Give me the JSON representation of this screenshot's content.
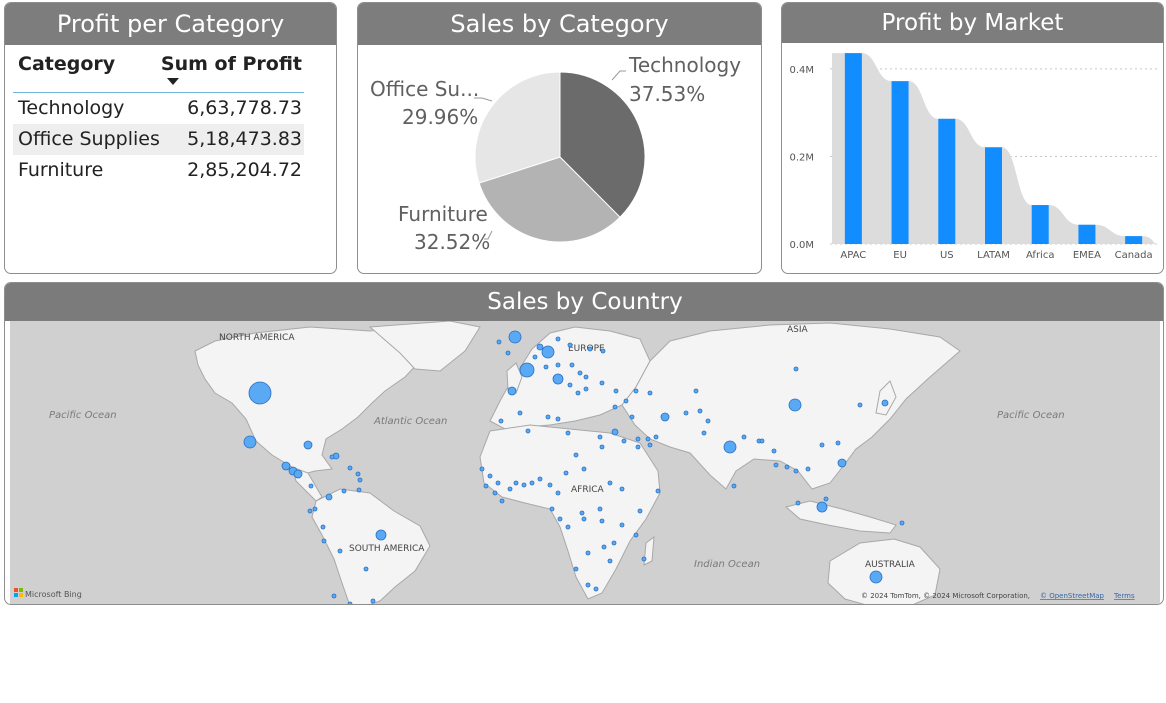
{
  "profit_table": {
    "title": "Profit per Category",
    "col_category": "Category",
    "col_profit": "Sum of Profit",
    "rows": [
      {
        "category": "Technology",
        "profit": "6,63,778.73"
      },
      {
        "category": "Office Supplies",
        "profit": "5,18,473.83"
      },
      {
        "category": "Furniture",
        "profit": "2,85,204.72"
      }
    ]
  },
  "sales_pie": {
    "title": "Sales by Category",
    "labels": [
      {
        "name": "Technology",
        "pct": "37.53%"
      },
      {
        "name": "Office Su...",
        "pct": "29.96%"
      },
      {
        "name": "Furniture",
        "pct": "32.52%"
      }
    ]
  },
  "market_chart": {
    "title": "Profit by Market"
  },
  "map": {
    "title": "Sales by Country",
    "labels": {
      "north_america": "NORTH AMERICA",
      "europe": "EUROPE",
      "asia": "ASIA",
      "africa": "AFRICA",
      "south_america": "SOUTH AMERICA",
      "australia": "AUSTRALIA",
      "pacific_w": "Pacific Ocean",
      "pacific_e": "Pacific Ocean",
      "atlantic": "Atlantic Ocean",
      "indian": "Indian Ocean"
    },
    "brand": "Microsoft Bing",
    "copyright": "© 2024 TomTom, © 2024 Microsoft Corporation,",
    "osm": "© OpenStreetMap",
    "terms": "Terms"
  },
  "chart_data": [
    {
      "type": "pie",
      "title": "Sales by Category",
      "labels": [
        "Technology",
        "Office Supplies",
        "Furniture"
      ],
      "values": [
        37.53,
        29.96,
        32.52
      ],
      "colors": [
        "#6b6b6b",
        "#e6e6e6",
        "#b3b3b3"
      ]
    },
    {
      "type": "bar",
      "title": "Profit by Market",
      "categories": [
        "APAC",
        "EU",
        "US",
        "LATAM",
        "Africa",
        "EMEA",
        "Canada"
      ],
      "values": [
        436000,
        372000,
        286000,
        221000,
        89000,
        44000,
        18000
      ],
      "ylim": [
        0,
        450000
      ],
      "yticks": [
        "0.0M",
        "0.2M",
        "0.4M"
      ],
      "ytick_values": [
        0,
        200000,
        400000
      ],
      "color": "#118dff",
      "grid": true
    }
  ]
}
